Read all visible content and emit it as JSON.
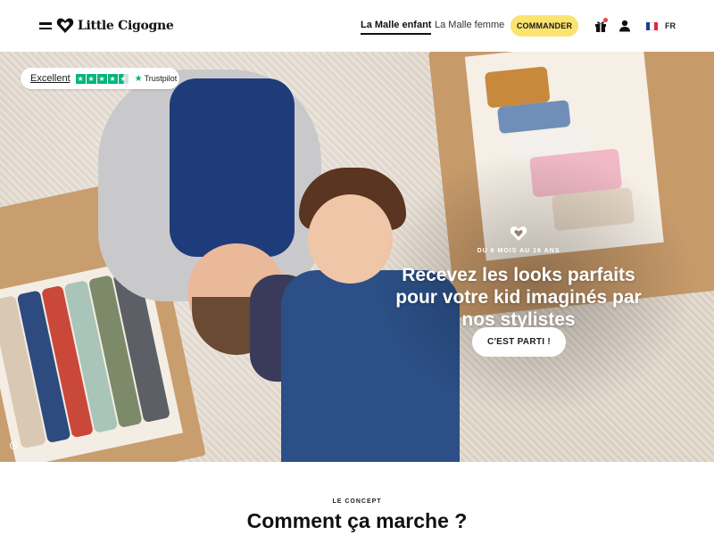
{
  "header": {
    "logo_text": "Little Cigogne",
    "nav": [
      {
        "label": "La Malle enfant",
        "active": true
      },
      {
        "label": "La Malle femme",
        "active": false
      }
    ],
    "order_button": "COMMANDER",
    "language": "FR",
    "icons": [
      "menu-icon",
      "heart-logo-icon",
      "gift-icon",
      "user-icon",
      "france-flag-icon"
    ]
  },
  "hero": {
    "trustpilot": {
      "rating_text": "Excellent",
      "brand": "Trustpilot",
      "stars": 4.5
    },
    "kicker": "DU 6 MOIS AU 16 ANS",
    "title": "Recevez les looks parfaits pour votre kid imaginés par nos stylistes",
    "cta": "C'EST PARTI !"
  },
  "concept": {
    "kicker": "LE CONCEPT",
    "title": "Comment ça marche ?"
  },
  "colors": {
    "accent_yellow": "#fbe36f",
    "trustpilot_green": "#00b67a",
    "notification_red": "#e2463f"
  }
}
